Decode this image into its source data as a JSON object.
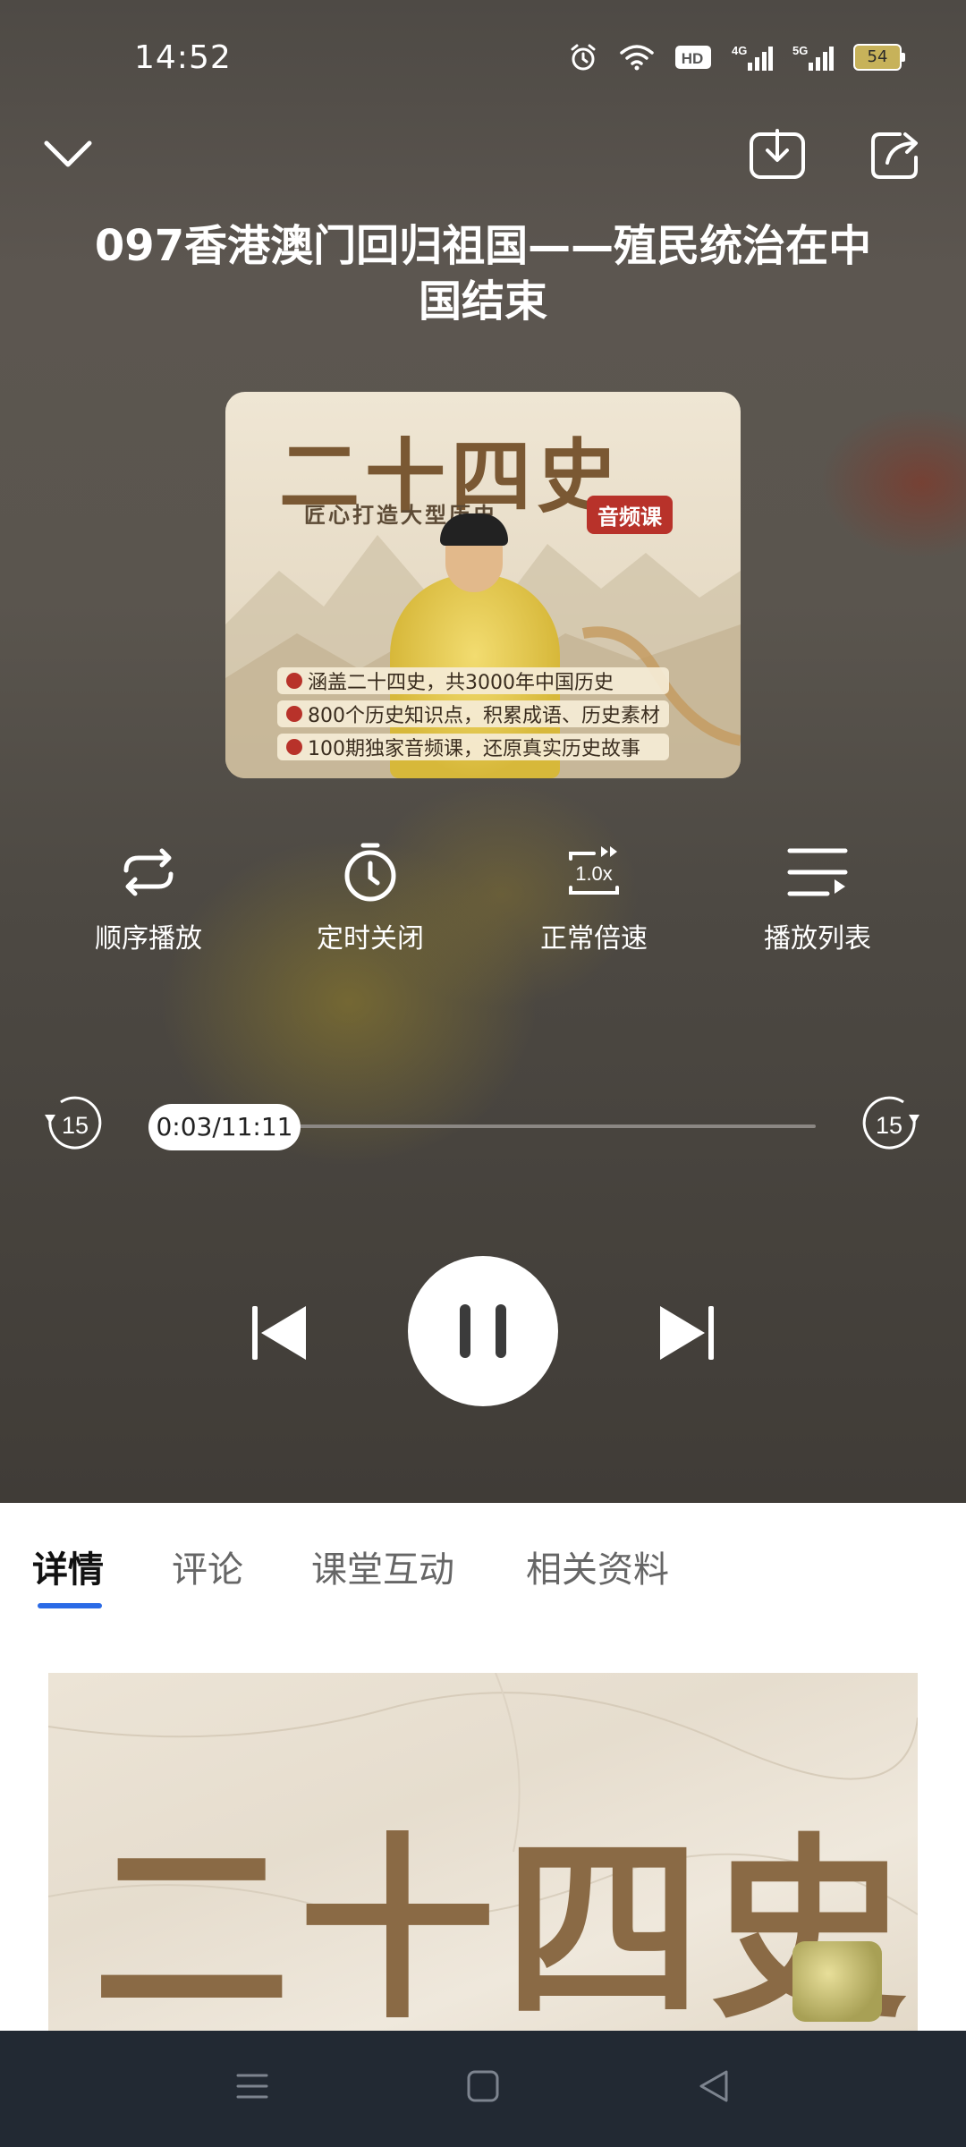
{
  "status_bar": {
    "time": "14:52",
    "battery": "54",
    "network_labels": [
      "HD",
      "4G",
      "5G"
    ]
  },
  "player": {
    "title": "097香港澳门回归祖国——殖民统治在中国结束",
    "cover": {
      "title": "二十四史",
      "subtitle": "匠心打造大型历史",
      "badge": "音频课",
      "lines": [
        "涵盖二十四史，共3000年中国历史",
        "800个历史知识点，积累成语、历史素材",
        "100期独家音频课，还原真实历史故事"
      ]
    },
    "controls": [
      {
        "label": "顺序播放",
        "icon": "repeat-icon"
      },
      {
        "label": "定时关闭",
        "icon": "timer-icon"
      },
      {
        "label": "正常倍速",
        "icon": "speed-icon",
        "badge": "1.0x"
      },
      {
        "label": "播放列表",
        "icon": "playlist-icon"
      }
    ],
    "progress": {
      "time_text": "0:03/11:11",
      "fraction": 0.0045,
      "skip_back_seconds": "15",
      "skip_forward_seconds": "15"
    }
  },
  "tabs": [
    {
      "label": "详情",
      "active": true
    },
    {
      "label": "评论",
      "active": false
    },
    {
      "label": "课堂互动",
      "active": false
    },
    {
      "label": "相关资料",
      "active": false
    }
  ],
  "detail": {
    "image_title": "二十四史"
  },
  "colors": {
    "accent": "#2b6be6",
    "nav_bar": "#222933",
    "badge_red": "#b8322a"
  }
}
